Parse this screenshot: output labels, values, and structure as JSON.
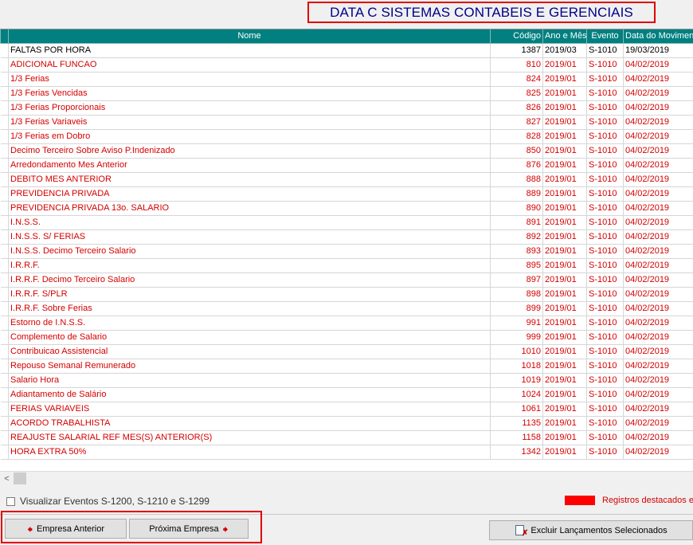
{
  "header": {
    "title": "DATA C SISTEMAS CONTABEIS E GERENCIAIS"
  },
  "grid": {
    "columns": [
      "Nome",
      "Código",
      "Ano e Mês",
      "Evento",
      "Data do Movimento"
    ],
    "rows": [
      {
        "nome": "FALTAS POR HORA",
        "codigo": "1387",
        "ano_mes": "2019/03",
        "evento": "S-1010",
        "data": "19/03/2019",
        "highlighted": false
      },
      {
        "nome": "ADICIONAL FUNCAO",
        "codigo": "810",
        "ano_mes": "2019/01",
        "evento": "S-1010",
        "data": "04/02/2019",
        "highlighted": true
      },
      {
        "nome": "1/3 Ferias",
        "codigo": "824",
        "ano_mes": "2019/01",
        "evento": "S-1010",
        "data": "04/02/2019",
        "highlighted": true
      },
      {
        "nome": "1/3 Ferias Vencidas",
        "codigo": "825",
        "ano_mes": "2019/01",
        "evento": "S-1010",
        "data": "04/02/2019",
        "highlighted": true
      },
      {
        "nome": "1/3 Ferias Proporcionais",
        "codigo": "826",
        "ano_mes": "2019/01",
        "evento": "S-1010",
        "data": "04/02/2019",
        "highlighted": true
      },
      {
        "nome": "1/3 Ferias Variaveis",
        "codigo": "827",
        "ano_mes": "2019/01",
        "evento": "S-1010",
        "data": "04/02/2019",
        "highlighted": true
      },
      {
        "nome": "1/3 Ferias em Dobro",
        "codigo": "828",
        "ano_mes": "2019/01",
        "evento": "S-1010",
        "data": "04/02/2019",
        "highlighted": true
      },
      {
        "nome": "Decimo Terceiro Sobre Aviso P.Indenizado",
        "codigo": "850",
        "ano_mes": "2019/01",
        "evento": "S-1010",
        "data": "04/02/2019",
        "highlighted": true
      },
      {
        "nome": "Arredondamento Mes Anterior",
        "codigo": "876",
        "ano_mes": "2019/01",
        "evento": "S-1010",
        "data": "04/02/2019",
        "highlighted": true
      },
      {
        "nome": "DEBITO MES ANTERIOR",
        "codigo": "888",
        "ano_mes": "2019/01",
        "evento": "S-1010",
        "data": "04/02/2019",
        "highlighted": true
      },
      {
        "nome": "PREVIDENCIA PRIVADA",
        "codigo": "889",
        "ano_mes": "2019/01",
        "evento": "S-1010",
        "data": "04/02/2019",
        "highlighted": true
      },
      {
        "nome": "PREVIDENCIA PRIVADA 13o. SALARIO",
        "codigo": "890",
        "ano_mes": "2019/01",
        "evento": "S-1010",
        "data": "04/02/2019",
        "highlighted": true
      },
      {
        "nome": "I.N.S.S.",
        "codigo": "891",
        "ano_mes": "2019/01",
        "evento": "S-1010",
        "data": "04/02/2019",
        "highlighted": true
      },
      {
        "nome": "I.N.S.S. S/ FERIAS",
        "codigo": "892",
        "ano_mes": "2019/01",
        "evento": "S-1010",
        "data": "04/02/2019",
        "highlighted": true
      },
      {
        "nome": "I.N.S.S. Decimo Terceiro Salario",
        "codigo": "893",
        "ano_mes": "2019/01",
        "evento": "S-1010",
        "data": "04/02/2019",
        "highlighted": true
      },
      {
        "nome": "I.R.R.F.",
        "codigo": "895",
        "ano_mes": "2019/01",
        "evento": "S-1010",
        "data": "04/02/2019",
        "highlighted": true
      },
      {
        "nome": "I.R.R.F. Decimo Terceiro Salario",
        "codigo": "897",
        "ano_mes": "2019/01",
        "evento": "S-1010",
        "data": "04/02/2019",
        "highlighted": true
      },
      {
        "nome": "I.R.R.F. S/PLR",
        "codigo": "898",
        "ano_mes": "2019/01",
        "evento": "S-1010",
        "data": "04/02/2019",
        "highlighted": true
      },
      {
        "nome": "I.R.R.F. Sobre Ferias",
        "codigo": "899",
        "ano_mes": "2019/01",
        "evento": "S-1010",
        "data": "04/02/2019",
        "highlighted": true
      },
      {
        "nome": "Estorno de I.N.S.S.",
        "codigo": "991",
        "ano_mes": "2019/01",
        "evento": "S-1010",
        "data": "04/02/2019",
        "highlighted": true
      },
      {
        "nome": "Complemento de Salario",
        "codigo": "999",
        "ano_mes": "2019/01",
        "evento": "S-1010",
        "data": "04/02/2019",
        "highlighted": true
      },
      {
        "nome": "Contribuicao  Assistencial",
        "codigo": "1010",
        "ano_mes": "2019/01",
        "evento": "S-1010",
        "data": "04/02/2019",
        "highlighted": true
      },
      {
        "nome": "Repouso Semanal Remunerado",
        "codigo": "1018",
        "ano_mes": "2019/01",
        "evento": "S-1010",
        "data": "04/02/2019",
        "highlighted": true
      },
      {
        "nome": "Salario Hora",
        "codigo": "1019",
        "ano_mes": "2019/01",
        "evento": "S-1010",
        "data": "04/02/2019",
        "highlighted": true
      },
      {
        "nome": "Adiantamento de Salário",
        "codigo": "1024",
        "ano_mes": "2019/01",
        "evento": "S-1010",
        "data": "04/02/2019",
        "highlighted": true
      },
      {
        "nome": "FERIAS VARIAVEIS",
        "codigo": "1061",
        "ano_mes": "2019/01",
        "evento": "S-1010",
        "data": "04/02/2019",
        "highlighted": true
      },
      {
        "nome": "ACORDO TRABALHISTA",
        "codigo": "1135",
        "ano_mes": "2019/01",
        "evento": "S-1010",
        "data": "04/02/2019",
        "highlighted": true
      },
      {
        "nome": "REAJUSTE SALARIAL REF MES(S) ANTERIOR(S)",
        "codigo": "1158",
        "ano_mes": "2019/01",
        "evento": "S-1010",
        "data": "04/02/2019",
        "highlighted": true
      },
      {
        "nome": "HORA EXTRA 50%",
        "codigo": "1342",
        "ano_mes": "2019/01",
        "evento": "S-1010",
        "data": "04/02/2019",
        "highlighted": true
      }
    ]
  },
  "scrollbar": {
    "left_arrow": "<"
  },
  "options": {
    "show_events_label": "Visualizar Eventos S-1200, S-1210 e S-1299",
    "show_events_checked": false
  },
  "legend": {
    "label": "Registros destacados em",
    "color": "#ff0000"
  },
  "buttons": {
    "prev_label": "Empresa Anterior",
    "next_label": "Próxima Empresa",
    "delete_label": "Excluir Lançamentos Selecionados"
  },
  "colors": {
    "header_bg": "#008080",
    "highlight_text": "#d40000",
    "annotation_border": "#e00000",
    "title_text": "#00008b"
  }
}
